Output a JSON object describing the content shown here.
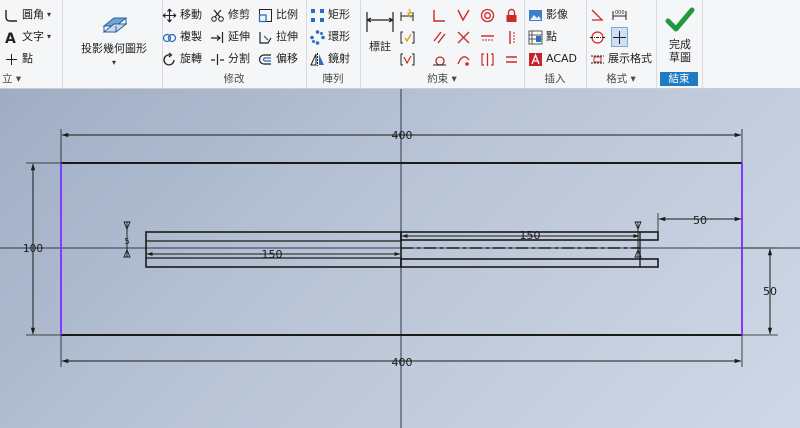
{
  "ribbon": {
    "draw": {
      "fillet_label": "圓角",
      "text_label": "文字",
      "point_label": "點",
      "title": "立"
    },
    "project": {
      "label": "投影幾何圖形"
    },
    "modify": {
      "title": "修改",
      "move": "移動",
      "copy": "複製",
      "rotate": "旋轉",
      "trim": "修剪",
      "extend": "延伸",
      "split": "分割",
      "scale": "比例",
      "stretch": "拉伸",
      "offset": "偏移"
    },
    "pattern": {
      "title": "陣列",
      "rectangular": "矩形",
      "circular": "環形",
      "mirror": "鏡射"
    },
    "constrain": {
      "title": "約束",
      "dimension": "標註"
    },
    "insert": {
      "title": "插入",
      "image": "影像",
      "points": "點",
      "acad": "ACAD"
    },
    "format": {
      "title": "格式",
      "show_format": "展示格式"
    },
    "exit": {
      "title": "結束",
      "finish_line1": "完成",
      "finish_line2": "草圖"
    }
  },
  "sketch": {
    "dims": {
      "top_width": "400",
      "bottom_width": "400",
      "height": "100",
      "right_offset": "50",
      "upper_slot": "150",
      "lower_slot": "150",
      "right_height": "50",
      "slot_small": "5"
    }
  },
  "colors": {
    "accent": "#1f7bc4",
    "finish_check": "#1f9a3e",
    "constraint_red": "#cc2a2a",
    "canvas_line": "#1a1a1a",
    "projected_edge": "#7d3cff"
  }
}
